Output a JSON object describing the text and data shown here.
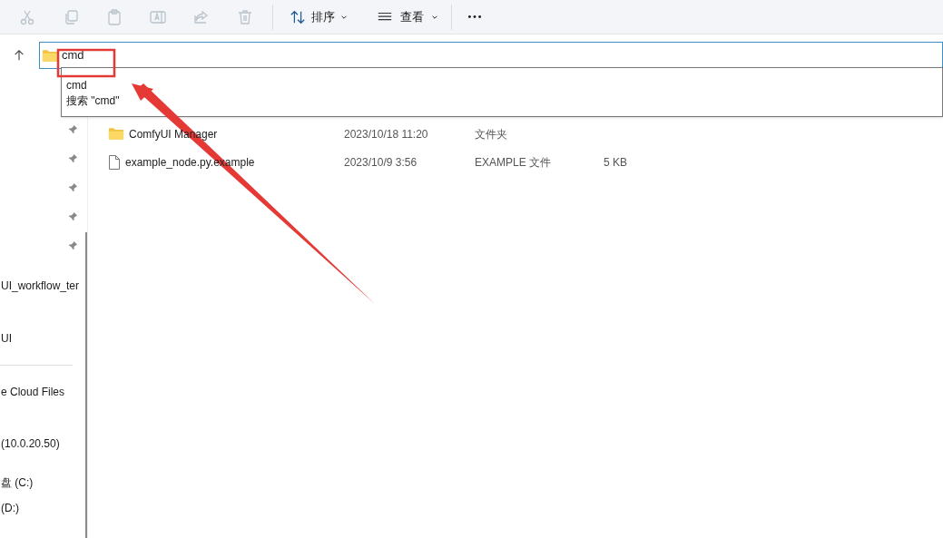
{
  "toolbar": {
    "actions": [
      {
        "kind": "cut",
        "disabled": true
      },
      {
        "kind": "copy",
        "disabled": true
      },
      {
        "kind": "paste",
        "disabled": true
      },
      {
        "kind": "rename",
        "disabled": true
      },
      {
        "kind": "share",
        "disabled": true
      },
      {
        "kind": "delete",
        "disabled": true
      }
    ],
    "sort": {
      "label": "排序"
    },
    "view": {
      "label": "查看"
    }
  },
  "address": {
    "value": "cmd",
    "suggestions": [
      "cmd",
      "搜索 \"cmd\""
    ]
  },
  "sidebar": {
    "items": [
      {
        "pinned": true
      },
      {
        "pinned": true
      },
      {
        "pinned": true
      },
      {
        "pinned": true
      },
      {
        "pinned": true
      },
      {
        "label": "UI_workflow_ter",
        "pinned": false
      },
      {
        "label": "UI",
        "pinned": false
      },
      {
        "label": "e Cloud Files",
        "pinned": false
      },
      {
        "label": "(10.0.20.50)",
        "pinned": false
      },
      {
        "label": "盘 (C:)",
        "pinned": false
      },
      {
        "label": "(D:)",
        "pinned": false
      }
    ]
  },
  "files": [
    {
      "kind": "folder",
      "name": "ComfyUI Manager",
      "date": "2023/10/18 11:20",
      "type": "文件夹"
    },
    {
      "kind": "file",
      "name": "example_node.py.example",
      "date": "2023/10/9 3:56",
      "type": "EXAMPLE 文件",
      "size": "5 KB"
    }
  ]
}
